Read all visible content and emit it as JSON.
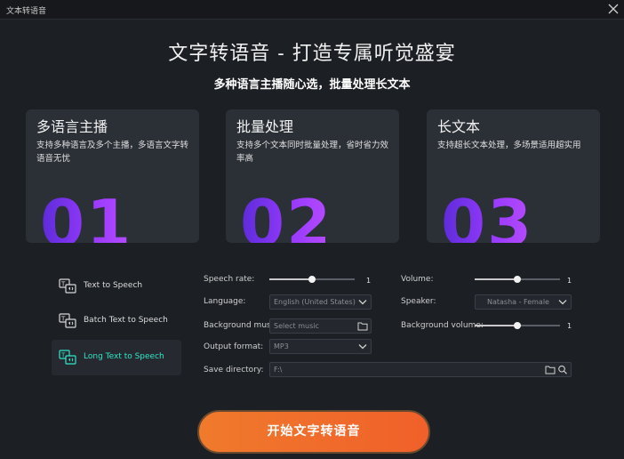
{
  "window": {
    "title": "文本转语音"
  },
  "header": {
    "headline": "文字转语音 - 打造专属听觉盛宴",
    "subhead": "多种语言主播随心选，批量处理长文本"
  },
  "cards": [
    {
      "title": "多语言主播",
      "desc": "支持多种语言及多个主播，多语言文字转语音无忧",
      "num": "01"
    },
    {
      "title": "批量处理",
      "desc": "支持多个文本同时批量处理，省时省力效率高",
      "num": "02"
    },
    {
      "title": "长文本",
      "desc": "支持超长文本处理，多场景适用超实用",
      "num": "03"
    }
  ],
  "sidebar": {
    "items": [
      {
        "label": "Text to Speech",
        "icon": "text-to-speech-icon"
      },
      {
        "label": "Batch Text to Speech",
        "icon": "batch-text-to-speech-icon"
      },
      {
        "label": "Long Text to Speech",
        "icon": "long-text-to-speech-icon"
      }
    ],
    "active_index": 2,
    "active_color": "#2ee6c8"
  },
  "settings": {
    "speech_rate": {
      "label": "Speech rate:",
      "value": "1",
      "level": 0.5
    },
    "volume": {
      "label": "Volume:",
      "value": "1",
      "level": 0.5
    },
    "language": {
      "label": "Language:",
      "value": "English (United States)"
    },
    "speaker": {
      "label": "Speaker:",
      "value": "Natasha - Female"
    },
    "background_music": {
      "label": "Background music:",
      "placeholder": "Select music"
    },
    "background_volume": {
      "label": "Background volume:",
      "value": "1",
      "level": 0.5
    },
    "output_format": {
      "label": "Output format:",
      "value": "MP3"
    },
    "save_directory": {
      "label": "Save directory:",
      "value": "F:\\"
    }
  },
  "start_button": {
    "label": "开始文字转语音",
    "color": "#f06a2b"
  }
}
